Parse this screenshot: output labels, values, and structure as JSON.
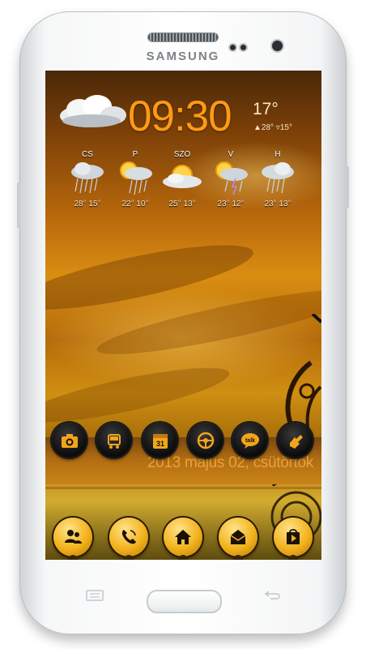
{
  "device": {
    "brand": "SAMSUNG"
  },
  "home": {
    "clock": {
      "time": "09:30"
    },
    "weather": {
      "current_temp": "17°",
      "range": "▲28° ▿15°",
      "icon": "cloudy-icon"
    },
    "forecast": [
      {
        "day": "CS",
        "temps": "28° 15°",
        "icon": "rain-cloud-icon"
      },
      {
        "day": "P",
        "temps": "22° 10°",
        "icon": "sun-rain-icon"
      },
      {
        "day": "SZO",
        "temps": "25° 13°",
        "icon": "sun-cloud-icon"
      },
      {
        "day": "V",
        "temps": "23° 12°",
        "icon": "sun-storm-icon"
      },
      {
        "day": "H",
        "temps": "23° 13°",
        "icon": "rain-cloud-icon"
      }
    ],
    "date": "2013 május 02, csütörtök",
    "shortcuts": [
      {
        "name": "camera-icon"
      },
      {
        "name": "car-icon"
      },
      {
        "name": "calendar-icon",
        "text": "31"
      },
      {
        "name": "steering-wheel-icon"
      },
      {
        "name": "talk-icon",
        "text": "talk"
      },
      {
        "name": "hand-tap-icon"
      }
    ],
    "dock": [
      {
        "name": "contacts-icon"
      },
      {
        "name": "phone-icon"
      },
      {
        "name": "home-icon"
      },
      {
        "name": "mail-icon"
      },
      {
        "name": "play-store-icon"
      }
    ]
  },
  "colors": {
    "clock": "#ff9a14",
    "date": "#e9a23a",
    "dock_gold": "#f2b21c"
  }
}
